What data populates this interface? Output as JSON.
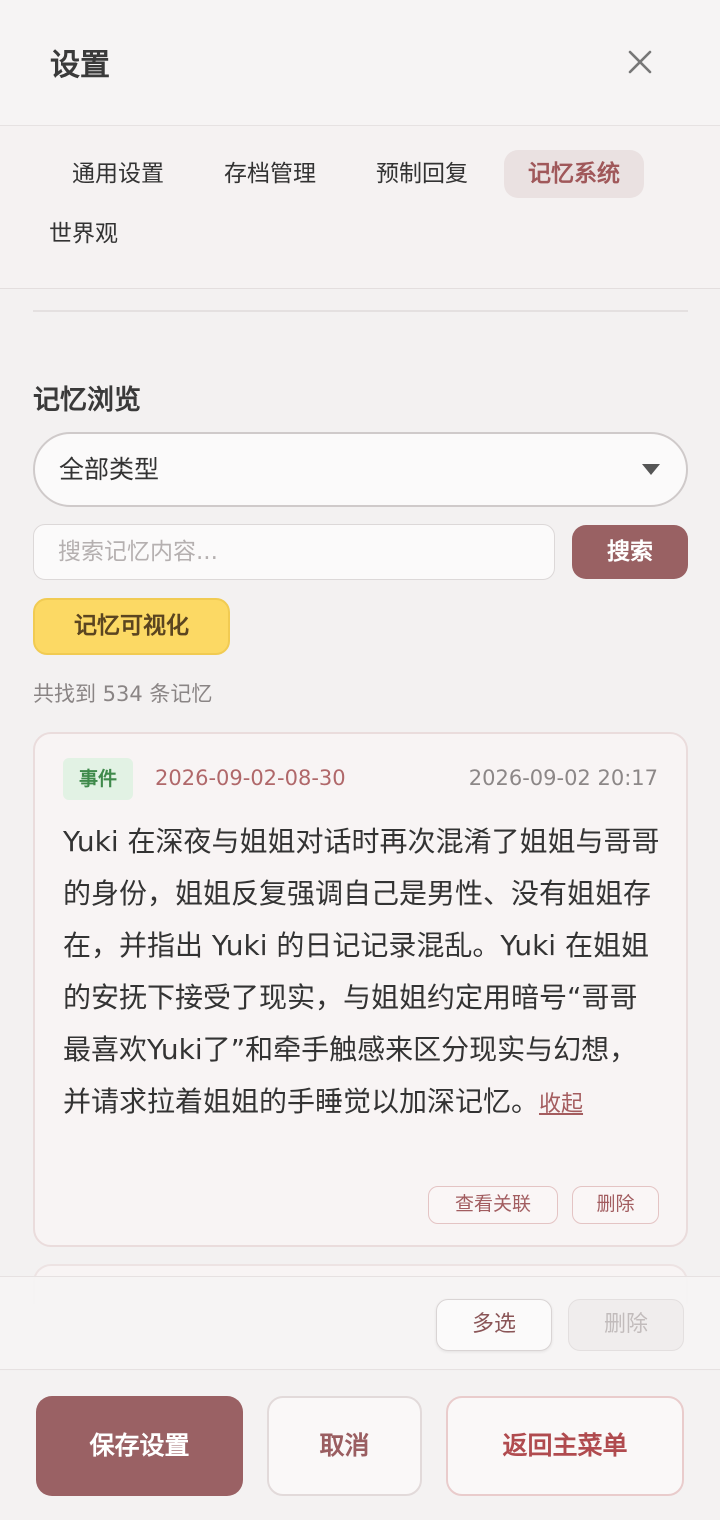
{
  "header": {
    "title": "设置"
  },
  "tabs": [
    {
      "label": "通用设置",
      "active": false
    },
    {
      "label": "存档管理",
      "active": false
    },
    {
      "label": "预制回复",
      "active": false
    },
    {
      "label": "记忆系统",
      "active": true
    },
    {
      "label": "世界观",
      "active": false
    }
  ],
  "memory": {
    "section_title": "记忆浏览",
    "type_select": {
      "value": "全部类型"
    },
    "search": {
      "placeholder": "搜索记忆内容...",
      "button": "搜索"
    },
    "visualize_button": "记忆可视化",
    "found_text": "共找到 534 条记忆",
    "items": [
      {
        "tag": "事件",
        "id": "2026-09-02-08-30",
        "timestamp": "2026-09-02 20:17",
        "content": "Yuki 在深夜与姐姐对话时再次混淆了姐姐与哥哥的身份，姐姐反复强调自己是男性、没有姐姐存在，并指出 Yuki 的日记记录混乱。Yuki 在姐姐的安抚下接受了现实，与姐姐约定用暗号“哥哥最喜欢Yuki了”和牵手触感来区分现实与幻想，并请求拉着姐姐的手睡觉以加深记忆。",
        "collapse": "收起",
        "view_related": "查看关联",
        "delete": "删除"
      }
    ],
    "multi_select": "多选",
    "bulk_delete": "删除"
  },
  "footer": {
    "save": "保存设置",
    "cancel": "取消",
    "back_to_menu": "返回主菜单"
  },
  "colors": {
    "accent": "#996163",
    "highlight": "#fcd964",
    "tag_bg": "#e2f2e4",
    "danger": "#b04b4f"
  }
}
